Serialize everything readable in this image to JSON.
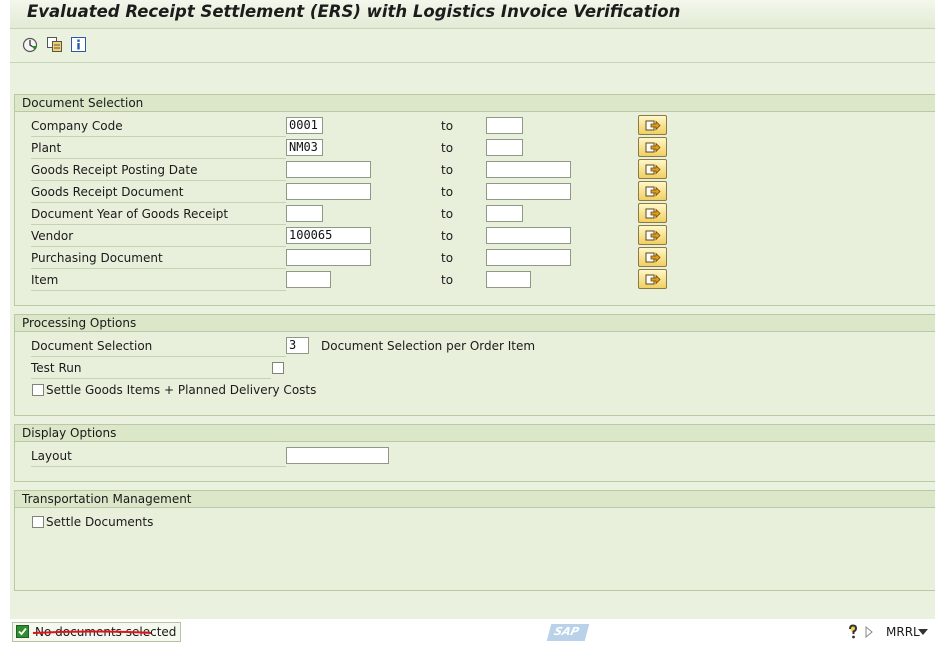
{
  "title": "Evaluated Receipt Settlement (ERS) with Logistics Invoice Verification",
  "toolbar": {
    "icons": [
      "execute-icon",
      "copy-variant-icon",
      "info-icon"
    ]
  },
  "document_selection": {
    "title": "Document Selection",
    "to_label": "to",
    "rows": [
      {
        "label": "Company Code",
        "from": "0001",
        "to": ""
      },
      {
        "label": "Plant",
        "from": "NM03",
        "to": ""
      },
      {
        "label": "Goods Receipt Posting Date",
        "from": "",
        "to": ""
      },
      {
        "label": "Goods Receipt Document",
        "from": "",
        "to": ""
      },
      {
        "label": "Document Year of Goods Receipt",
        "from": "",
        "to": ""
      },
      {
        "label": "Vendor",
        "from": "100065",
        "to": ""
      },
      {
        "label": "Purchasing Document",
        "from": "",
        "to": ""
      },
      {
        "label": "Item",
        "from": "",
        "to": ""
      }
    ]
  },
  "processing_options": {
    "title": "Processing Options",
    "doc_selection_label": "Document Selection",
    "doc_selection_value": "3",
    "doc_selection_desc": "Document Selection per Order Item",
    "test_run_label": "Test Run",
    "test_run_checked": false,
    "settle_label": "Settle Goods Items + Planned Delivery Costs",
    "settle_checked": false
  },
  "display_options": {
    "title": "Display Options",
    "layout_label": "Layout",
    "layout_value": ""
  },
  "transportation": {
    "title": "Transportation Management",
    "settle_docs_label": "Settle Documents",
    "settle_docs_checked": false
  },
  "status": {
    "message": "No documents selected",
    "system": "MRRL",
    "logo": "SAP"
  },
  "colors": {
    "background": "#eaf1de",
    "group_header": "#dbe7c8",
    "multi_button": "#f1cf62"
  }
}
